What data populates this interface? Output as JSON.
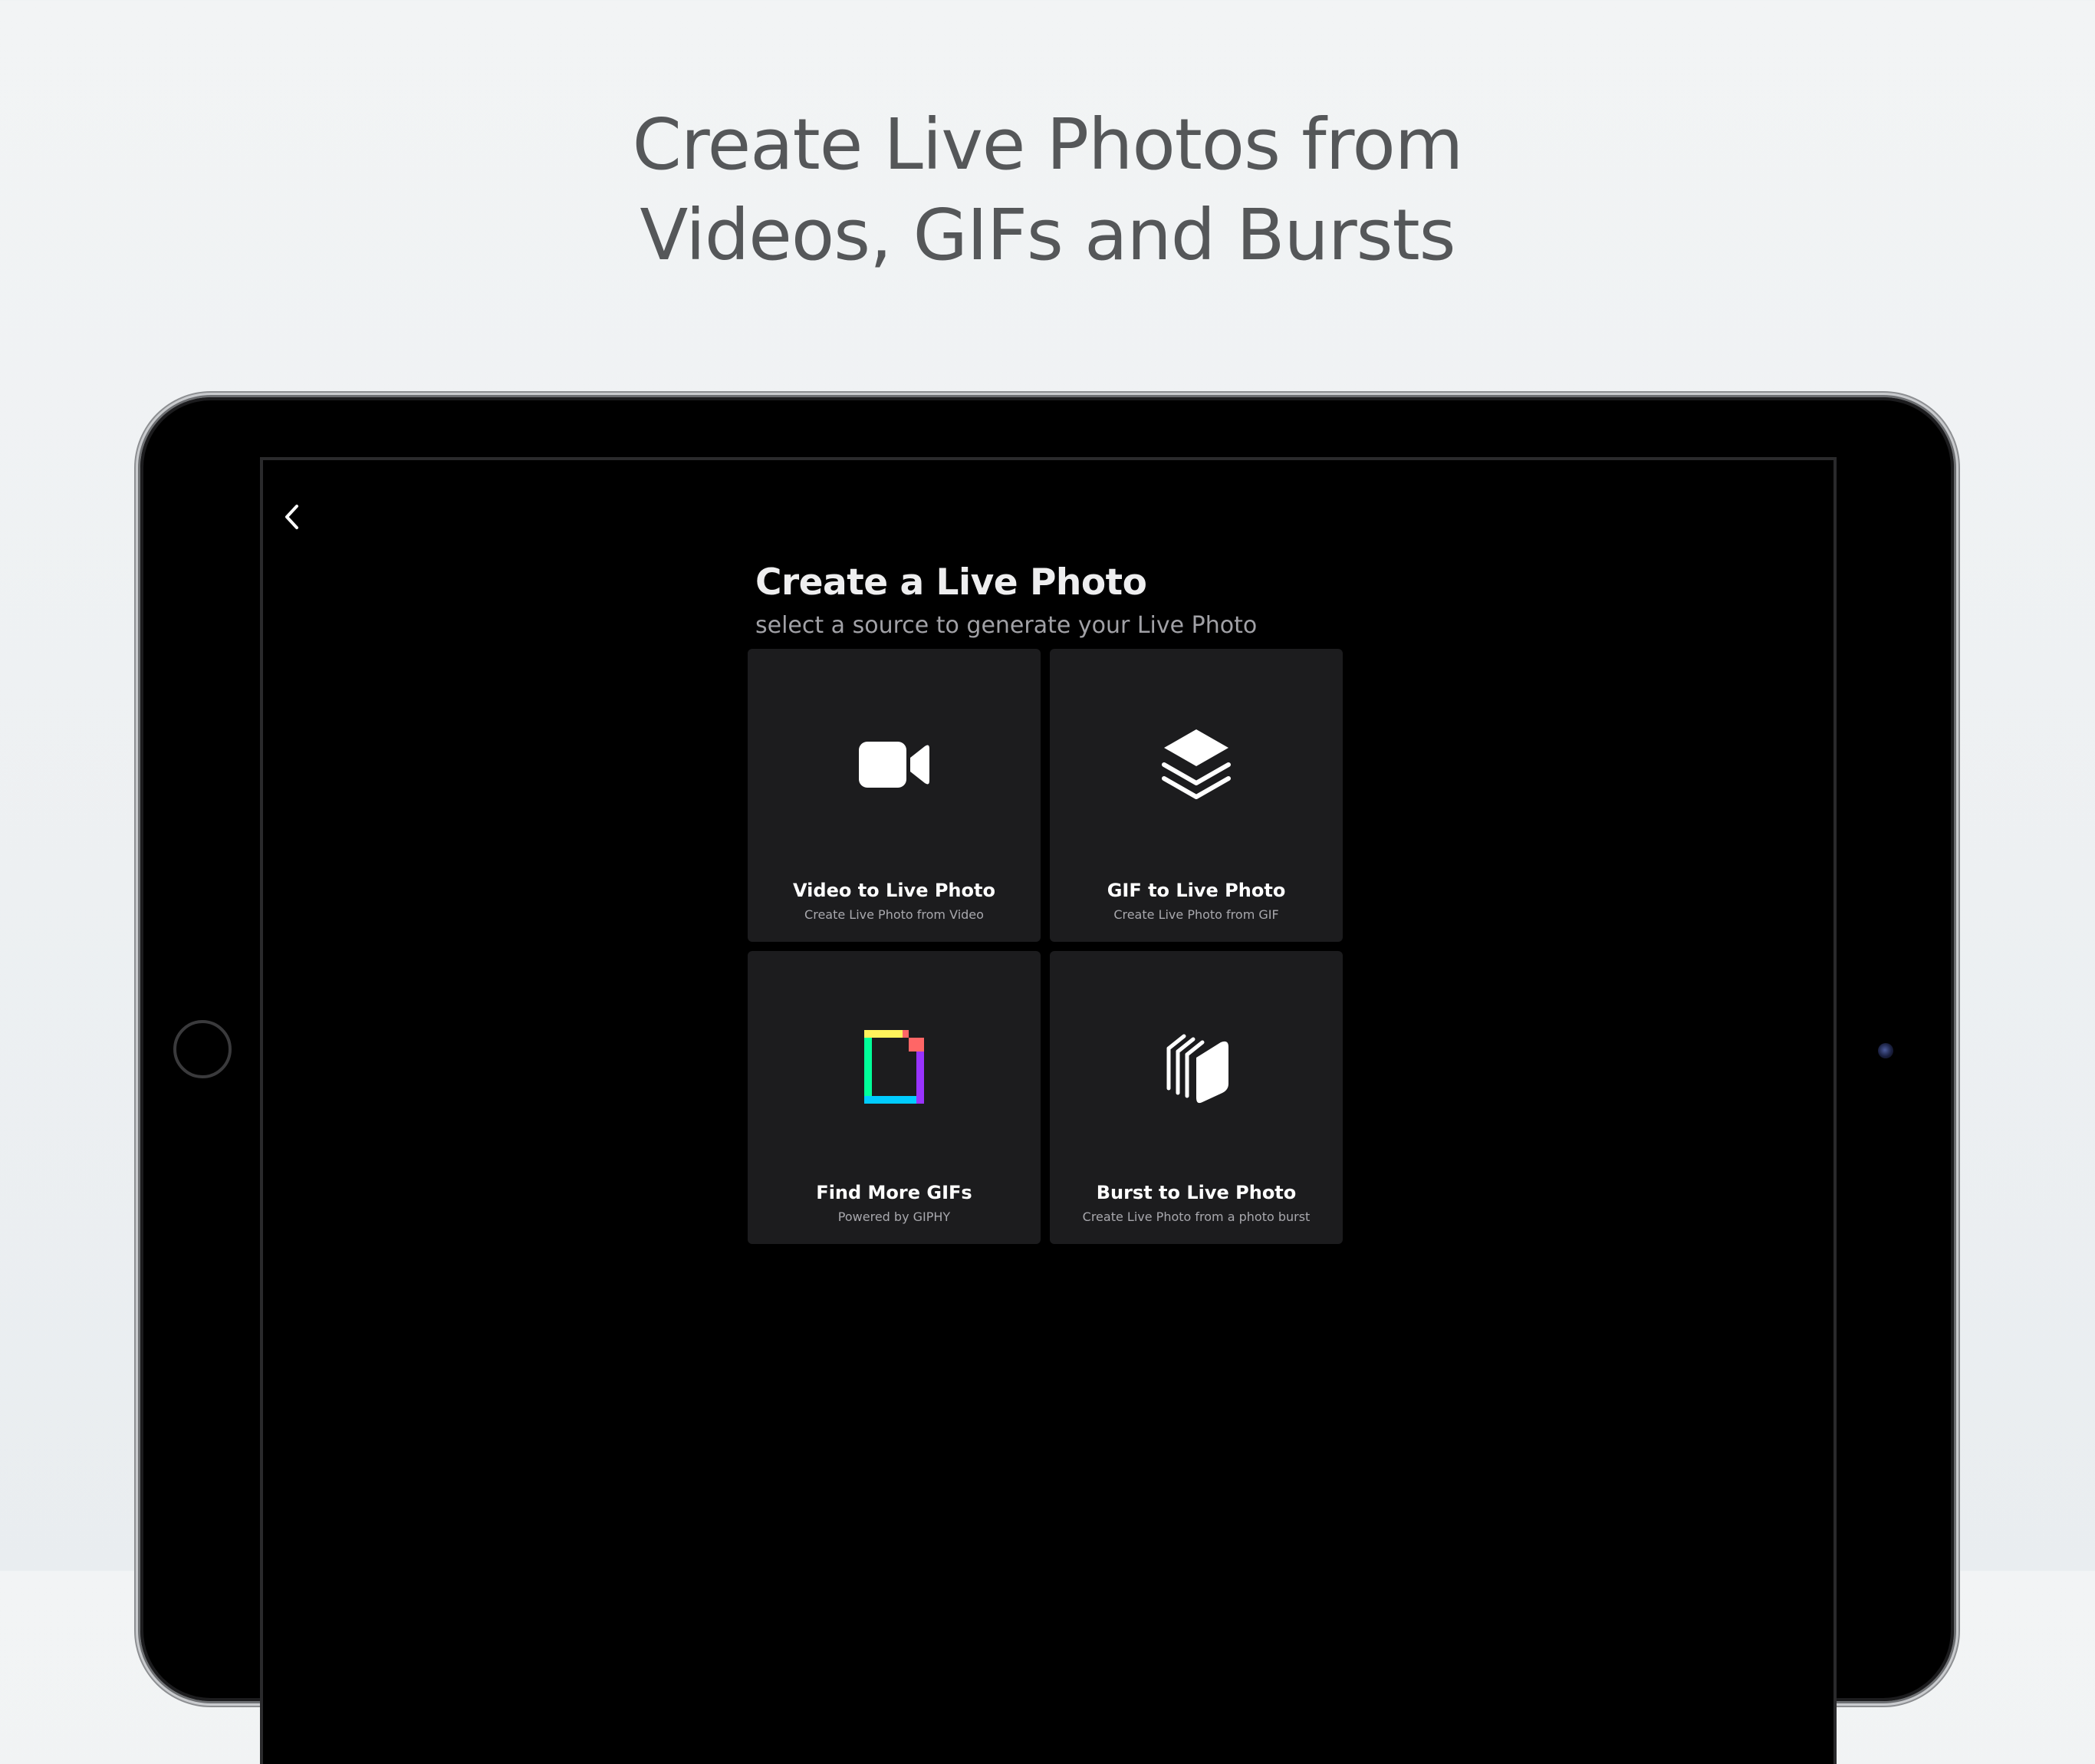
{
  "headline": {
    "line1": "Create Live Photos from",
    "line2": "Videos, GIFs and Bursts"
  },
  "screen": {
    "title": "Create a Live Photo",
    "subtitle": "select a source to generate your Live Photo",
    "back_icon": "chevron-left-icon",
    "options": [
      {
        "title": "Video to Live Photo",
        "subtitle": "Create Live Photo from Video",
        "icon": "video-camera-icon"
      },
      {
        "title": "GIF to Live Photo",
        "subtitle": "Create Live Photo from GIF",
        "icon": "layers-stack-icon"
      },
      {
        "title": "Find More GIFs",
        "subtitle": "Powered by GIPHY",
        "icon": "giphy-logo-icon"
      },
      {
        "title": "Burst to Live Photo",
        "subtitle": "Create Live Photo from a photo burst",
        "icon": "photo-burst-icon"
      }
    ]
  },
  "colors": {
    "background": "#f2f4f5",
    "headline": "#555759",
    "card": "#1c1c1e",
    "screen": "#000000"
  }
}
